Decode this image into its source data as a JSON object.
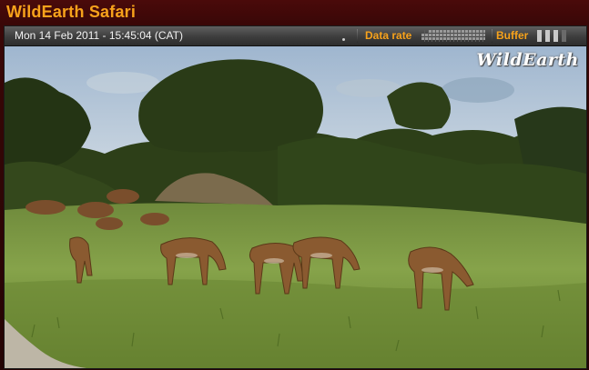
{
  "app": {
    "title": "WildEarth Safari"
  },
  "toolbar": {
    "timestamp": "Mon 14 Feb 2011 - 15:45:04 (CAT)",
    "data_rate_label": "Data rate",
    "buffer_label": "Buffer",
    "buffer_level": 0.75
  },
  "video": {
    "watermark": "WildEarth"
  },
  "colors": {
    "accent": "#f7a21b",
    "frame": "#3a0707",
    "toolbar": "#4a4a4a"
  }
}
